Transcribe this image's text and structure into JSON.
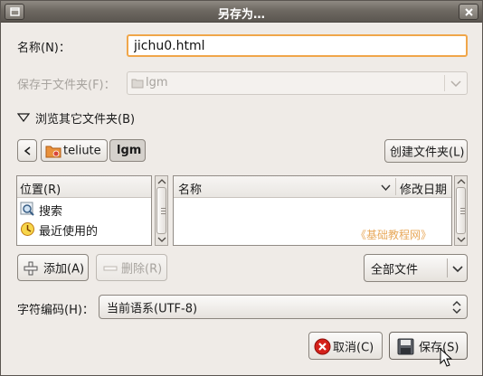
{
  "window": {
    "title": "另存为…"
  },
  "form": {
    "name_label": "名称(N)：",
    "name_value": "jichu0.html",
    "save_in_label": "保存于文件夹(F)：",
    "save_in_value": "lgm"
  },
  "browser": {
    "expander_label": "浏览其它文件夹(B)",
    "path_buttons": [
      "teliute",
      "lgm"
    ],
    "create_folder_label": "创建文件夹(L)"
  },
  "places": {
    "header": "位置(R)",
    "items": [
      {
        "label": "搜索",
        "icon": "search-icon"
      },
      {
        "label": "最近使用的",
        "icon": "recent-icon"
      }
    ]
  },
  "files": {
    "columns": [
      "名称",
      "修改日期"
    ],
    "watermark": "《基础教程网》"
  },
  "actions": {
    "add_label": "添加(A)",
    "remove_label": "删除(R)",
    "filter_value": "全部文件",
    "encoding_label": "字符编码(H)：",
    "encoding_value": "当前语系(UTF-8)",
    "cancel_label": "取消(C)",
    "save_label": "保存(S)"
  },
  "colors": {
    "focus_border": "#f0a64a",
    "titlebar": "#6e6962",
    "dialog_bg": "#efebe7"
  }
}
